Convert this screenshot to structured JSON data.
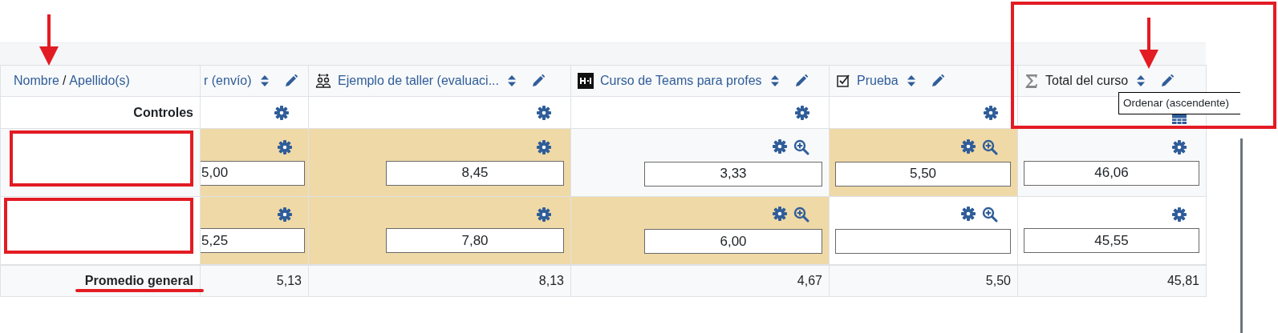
{
  "table": {
    "name_header": {
      "first": "Nombre",
      "separator": "/",
      "last": "Apellido(s)"
    },
    "columns": [
      {
        "kind": "assign",
        "title": "r (envío)",
        "clipped": true,
        "analysis": false
      },
      {
        "kind": "workshop",
        "title": "Ejemplo de taller (evaluaci...",
        "clipped": false,
        "analysis": false
      },
      {
        "kind": "h5p",
        "title": "Curso de Teams para profes",
        "clipped": false,
        "analysis": true
      },
      {
        "kind": "quiz",
        "title": "Prueba",
        "clipped": false,
        "analysis": true
      },
      {
        "kind": "total",
        "title": "Total del curso",
        "clipped": false,
        "analysis": false
      }
    ],
    "controls_label": "Controles",
    "rows": [
      {
        "cells": [
          {
            "value": "5,00",
            "overridden": true
          },
          {
            "value": "8,45",
            "overridden": true
          },
          {
            "value": "3,33",
            "overridden": false
          },
          {
            "value": "5,50",
            "overridden": true
          },
          {
            "value": "46,06",
            "overridden": false
          }
        ]
      },
      {
        "cells": [
          {
            "value": "5,25",
            "overridden": true
          },
          {
            "value": "7,80",
            "overridden": true
          },
          {
            "value": "6,00",
            "overridden": true
          },
          {
            "overridden": false
          },
          {
            "value": "45,55",
            "overridden": false
          }
        ]
      }
    ],
    "average": {
      "label": "Promedio general",
      "values": [
        "5,13",
        "8,13",
        "4,67",
        "5,50",
        "45,81"
      ]
    }
  },
  "tooltip": {
    "text": "Ordenar (ascendente)"
  }
}
